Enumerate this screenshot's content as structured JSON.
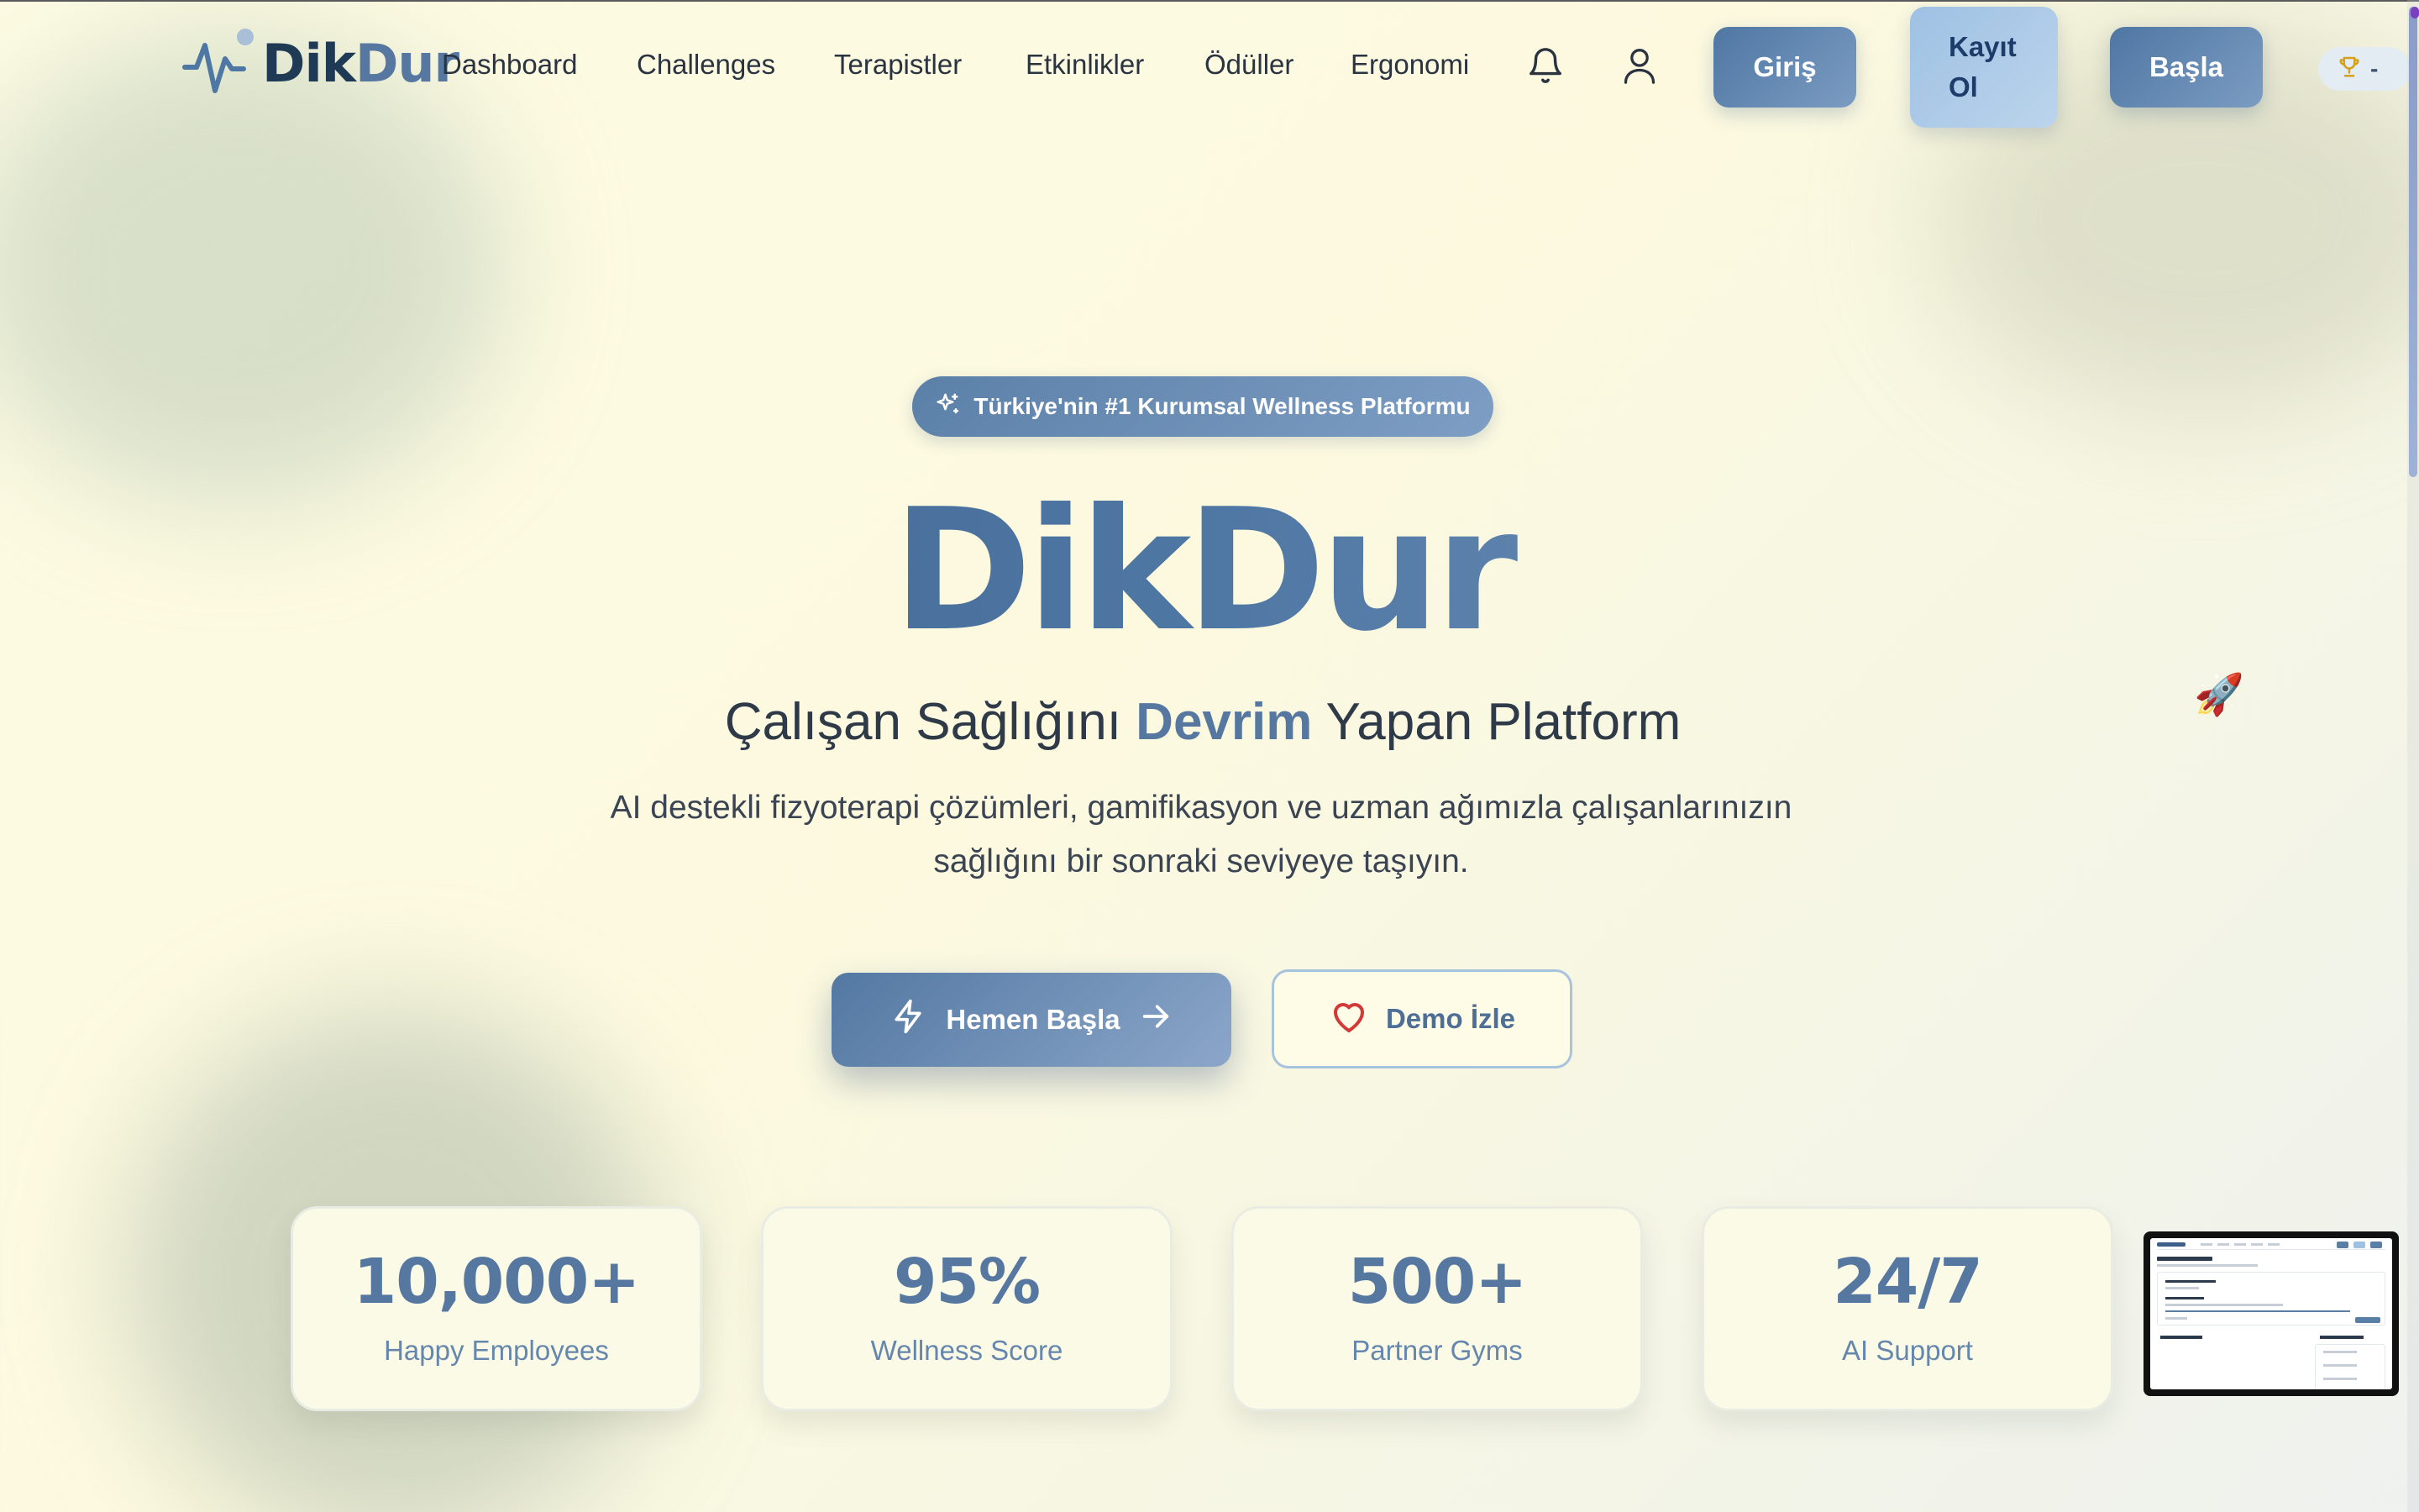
{
  "brand": {
    "name_part1": "Dik",
    "name_part2": "Dur"
  },
  "nav": {
    "links": [
      "Dashboard",
      "Challenges",
      "Terapistler",
      "Etkinlikler",
      "Ödüller",
      "Ergonomi"
    ],
    "login_label": "Giriş",
    "register_label_line1": "Kayıt",
    "register_label_line2": "Ol",
    "start_label": "Başla",
    "score_value": "-"
  },
  "hero": {
    "badge": "Türkiye'nin #1 Kurumsal Wellness Platformu",
    "title": "DikDur",
    "subtitle_pre": "Çalışan Sağlığını ",
    "subtitle_highlight": "Devrim",
    "subtitle_post": " Yapan Platform",
    "description_line1": "AI destekli fizyoterapi çözümleri, gamifikasyon ve uzman ağımızla çalışanlarınızın",
    "description_line2": "sağlığını bir sonraki seviyeye taşıyın.",
    "rocket_emoji": "🚀",
    "primary_cta": "Hemen Başla",
    "secondary_cta": "Demo İzle"
  },
  "stats": [
    {
      "value": "10,000+",
      "label": "Happy Employees"
    },
    {
      "value": "95%",
      "label": "Wellness Score"
    },
    {
      "value": "500+",
      "label": "Partner Gyms"
    },
    {
      "value": "24/7",
      "label": "AI Support"
    }
  ],
  "icons": {
    "logo": "heartbeat-pulse-icon",
    "notifications": "bell-icon",
    "profile": "user-icon",
    "score": "trophy-icon",
    "badge": "sparkles-icon",
    "primary_cta": "lightning-icon",
    "primary_cta_trailing": "arrow-right-icon",
    "secondary_cta": "heart-icon"
  },
  "colors": {
    "brand_dark": "#1f3a55",
    "brand_accent": "#5577a0",
    "button_gradient_start": "#4f77a3",
    "button_gradient_end": "#7b9cc2",
    "background": "#fdfbe3",
    "heart": "#d23a3a"
  }
}
